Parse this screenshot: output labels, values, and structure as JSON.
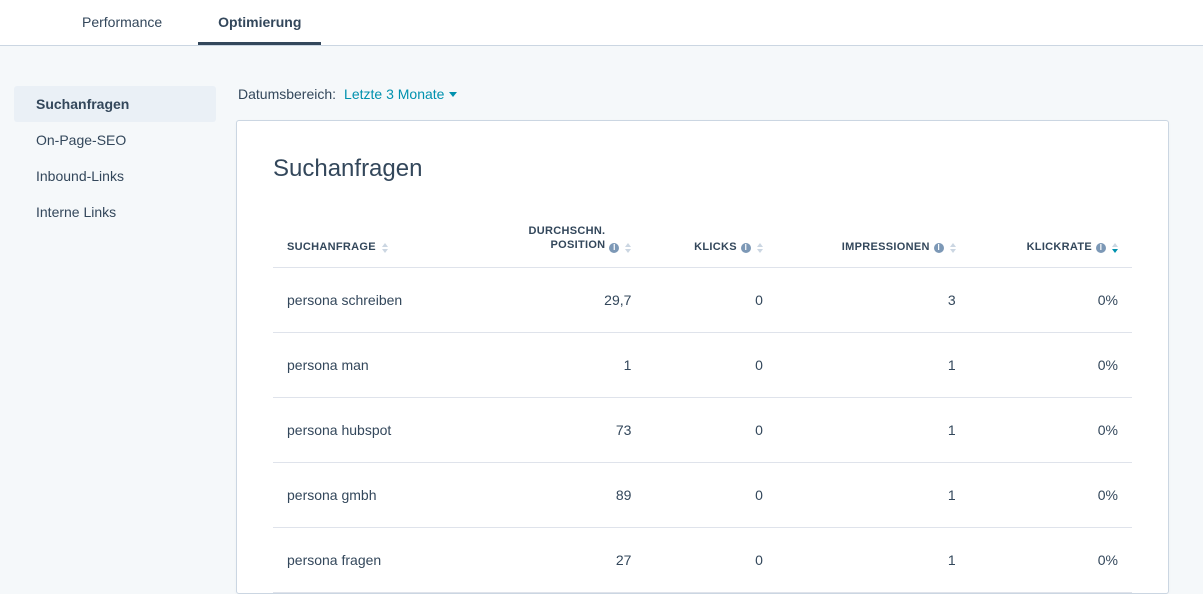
{
  "tabs": {
    "items": [
      {
        "label": "Performance",
        "active": false
      },
      {
        "label": "Optimierung",
        "active": true
      }
    ]
  },
  "sidebar": {
    "items": [
      {
        "label": "Suchanfragen",
        "active": true
      },
      {
        "label": "On-Page-SEO",
        "active": false
      },
      {
        "label": "Inbound-Links",
        "active": false
      },
      {
        "label": "Interne Links",
        "active": false
      }
    ]
  },
  "daterange": {
    "label": "Datumsbereich:",
    "value": "Letzte 3 Monate"
  },
  "panel": {
    "title": "Suchanfragen"
  },
  "table": {
    "headers": {
      "query": "SUCHANFRAGE",
      "position_line1": "DURCHSCHN.",
      "position_line2": "POSITION",
      "clicks": "KLICKS",
      "impressions": "IMPRESSIONEN",
      "ctr": "KLICKRATE"
    },
    "rows": [
      {
        "query": "persona schreiben",
        "position": "29,7",
        "clicks": "0",
        "impressions": "3",
        "ctr": "0%"
      },
      {
        "query": "persona man",
        "position": "1",
        "clicks": "0",
        "impressions": "1",
        "ctr": "0%"
      },
      {
        "query": "persona hubspot",
        "position": "73",
        "clicks": "0",
        "impressions": "1",
        "ctr": "0%"
      },
      {
        "query": "persona gmbh",
        "position": "89",
        "clicks": "0",
        "impressions": "1",
        "ctr": "0%"
      },
      {
        "query": "persona fragen",
        "position": "27",
        "clicks": "0",
        "impressions": "1",
        "ctr": "0%"
      }
    ]
  }
}
